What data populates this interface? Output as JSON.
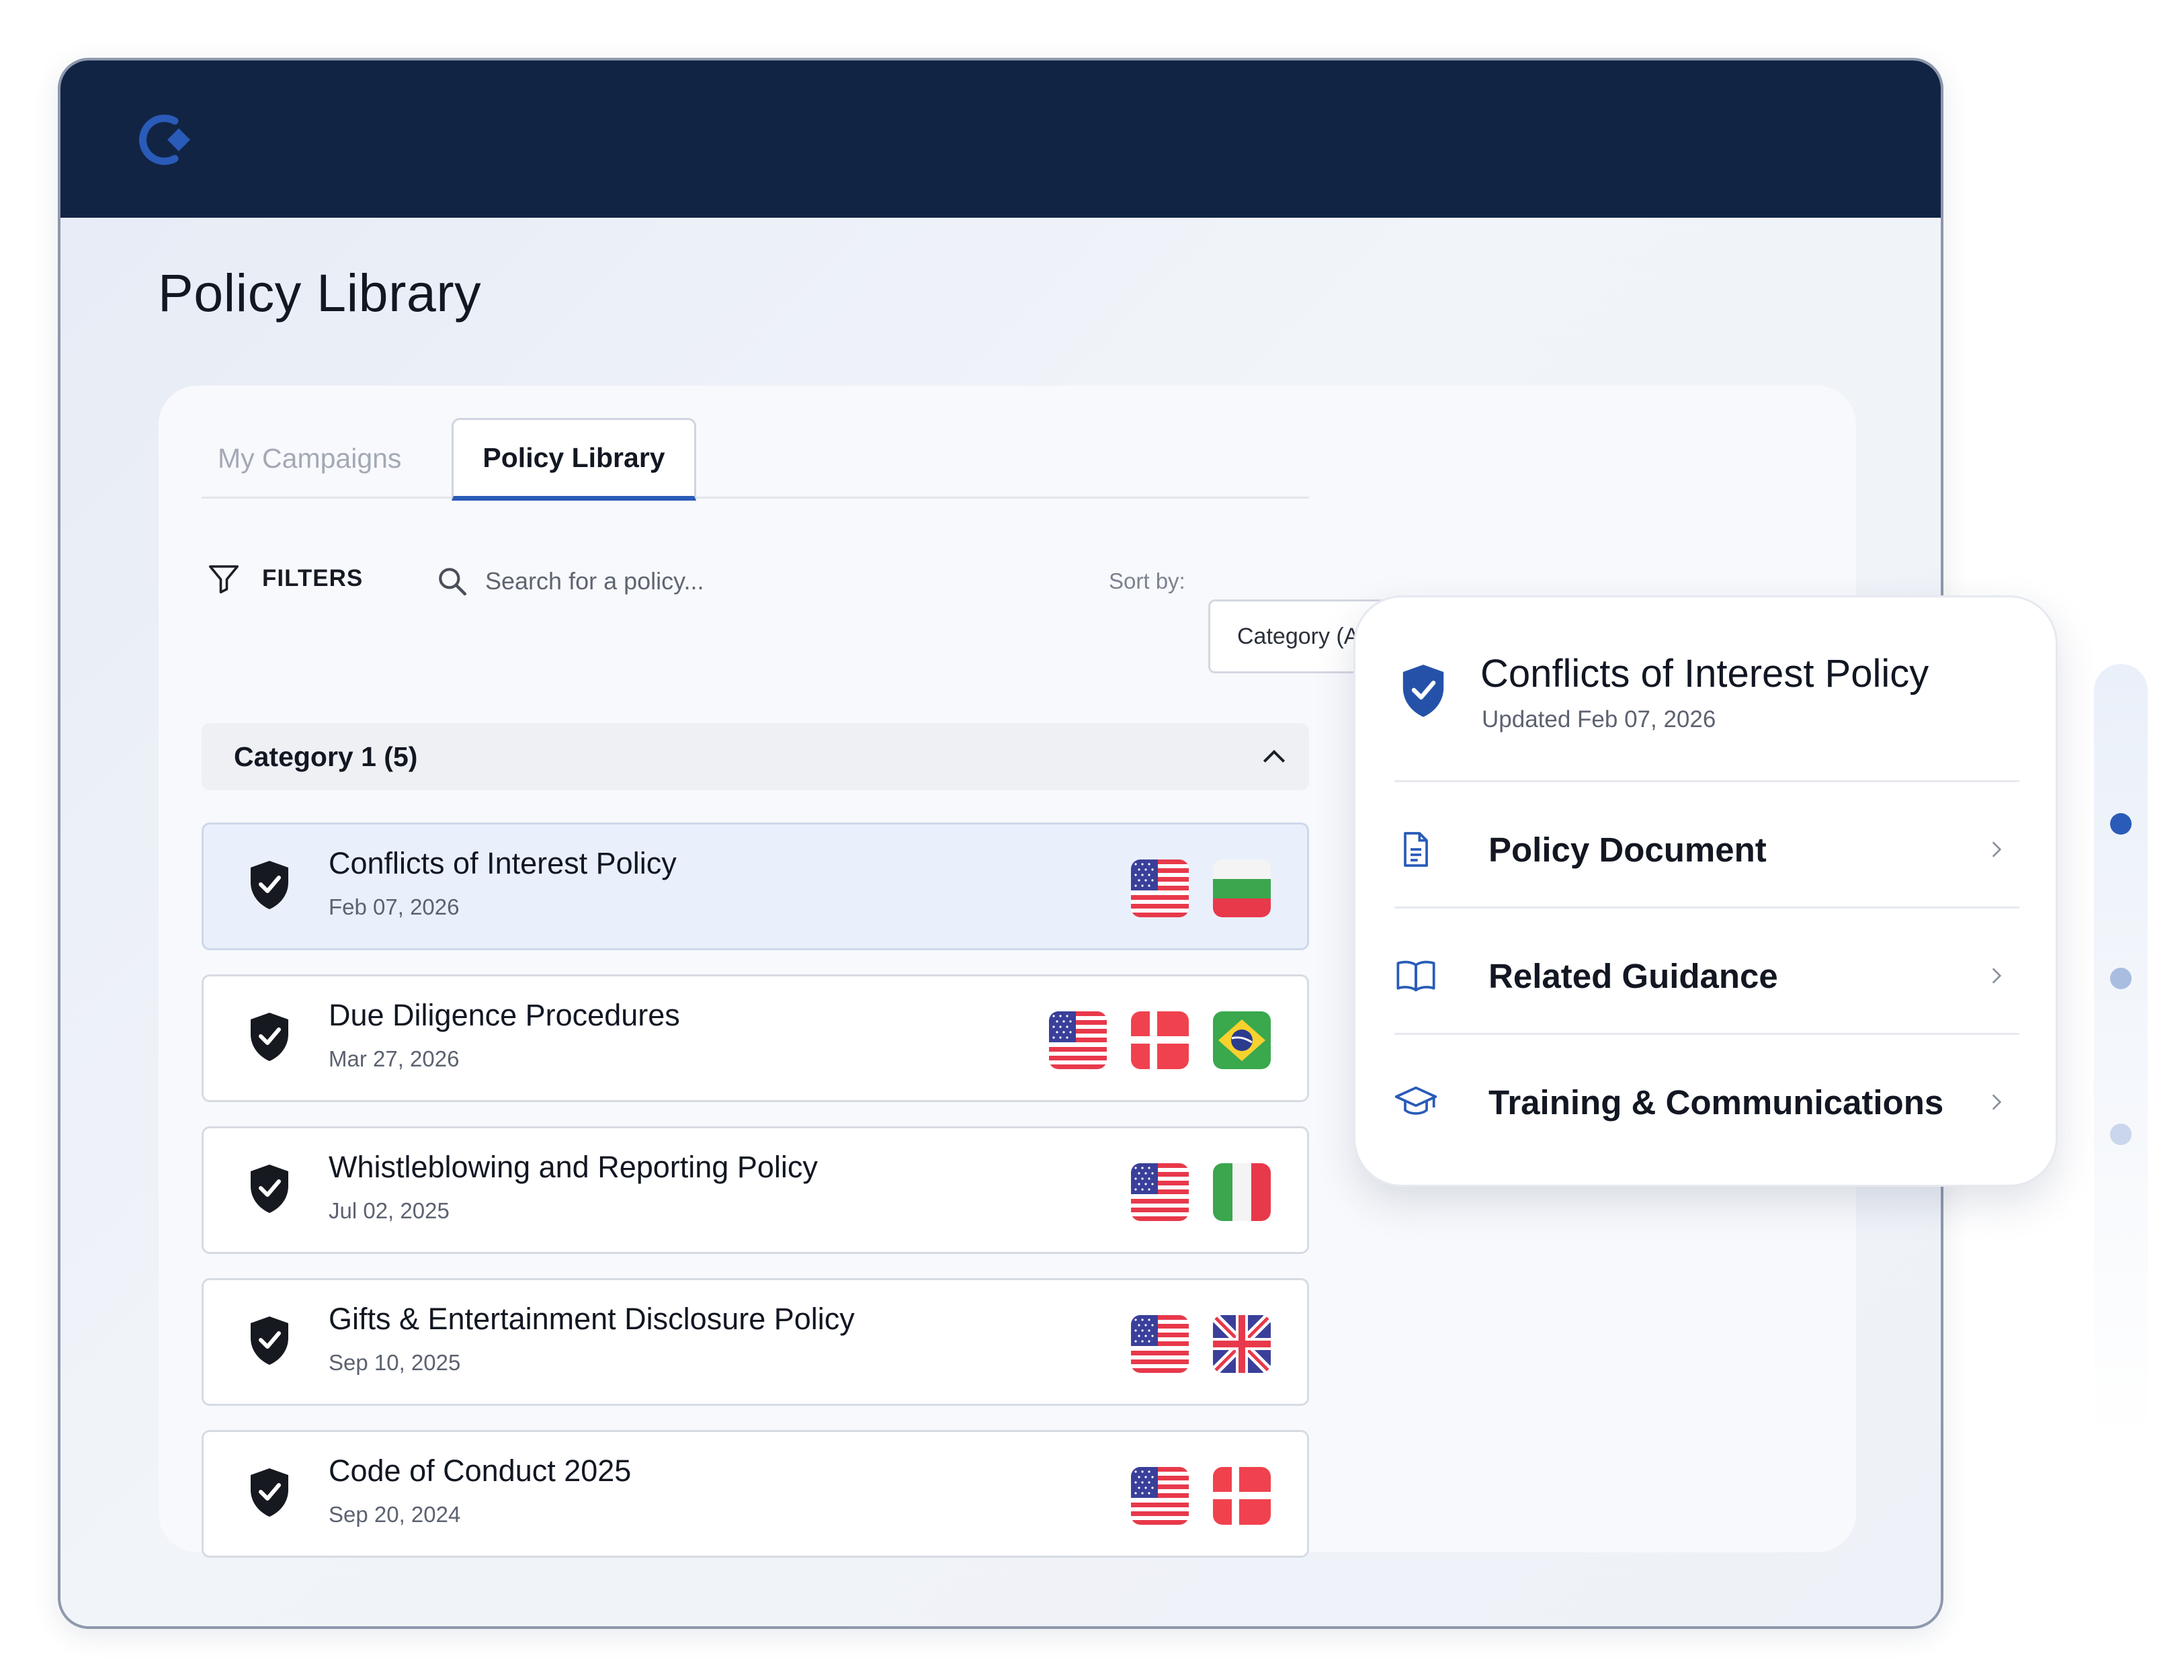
{
  "header": {
    "page_title": "Policy Library"
  },
  "tabs": [
    {
      "label": "My Campaigns",
      "active": false
    },
    {
      "label": "Policy Library",
      "active": true
    }
  ],
  "toolbar": {
    "filters_label": "FILTERS",
    "search_placeholder": "Search for a policy...",
    "sort_label": "Sort by:",
    "sort_value": "Category (A-Z)"
  },
  "category": {
    "label": "Category 1 (5)",
    "expanded": true
  },
  "policies": [
    {
      "title": "Conflicts of Interest Policy",
      "date": "Feb 07, 2026",
      "selected": true,
      "flags": [
        "us-flag",
        "bulgaria-flag"
      ]
    },
    {
      "title": "Due Diligence Procedures",
      "date": "Mar 27, 2026",
      "selected": false,
      "flags": [
        "us-flag",
        "denmark-flag",
        "brazil-flag"
      ]
    },
    {
      "title": "Whistleblowing and Reporting Policy",
      "date": "Jul 02, 2025",
      "selected": false,
      "flags": [
        "us-flag",
        "italy-flag"
      ]
    },
    {
      "title": "Gifts & Entertainment Disclosure Policy",
      "date": "Sep 10, 2025",
      "selected": false,
      "flags": [
        "us-flag",
        "uk-flag"
      ]
    },
    {
      "title": "Code of Conduct 2025",
      "date": "Sep 20, 2024",
      "selected": false,
      "flags": [
        "us-flag",
        "denmark-flag"
      ]
    }
  ],
  "detail": {
    "title": "Conflicts of Interest Policy",
    "updated": "Updated Feb 07, 2026",
    "items": [
      {
        "label": "Policy Document",
        "icon": "document-icon"
      },
      {
        "label": "Related Guidance",
        "icon": "book-icon"
      },
      {
        "label": "Training & Communications",
        "icon": "graduation-cap-icon"
      }
    ]
  },
  "pager": {
    "dots": 3,
    "active_index": 0
  },
  "colors": {
    "topbar": "#112444",
    "accent": "#2a5bb8",
    "selected_row": "#e9f0fc",
    "shield_dark": "#16191f",
    "shield_blue": "#2552a8"
  }
}
